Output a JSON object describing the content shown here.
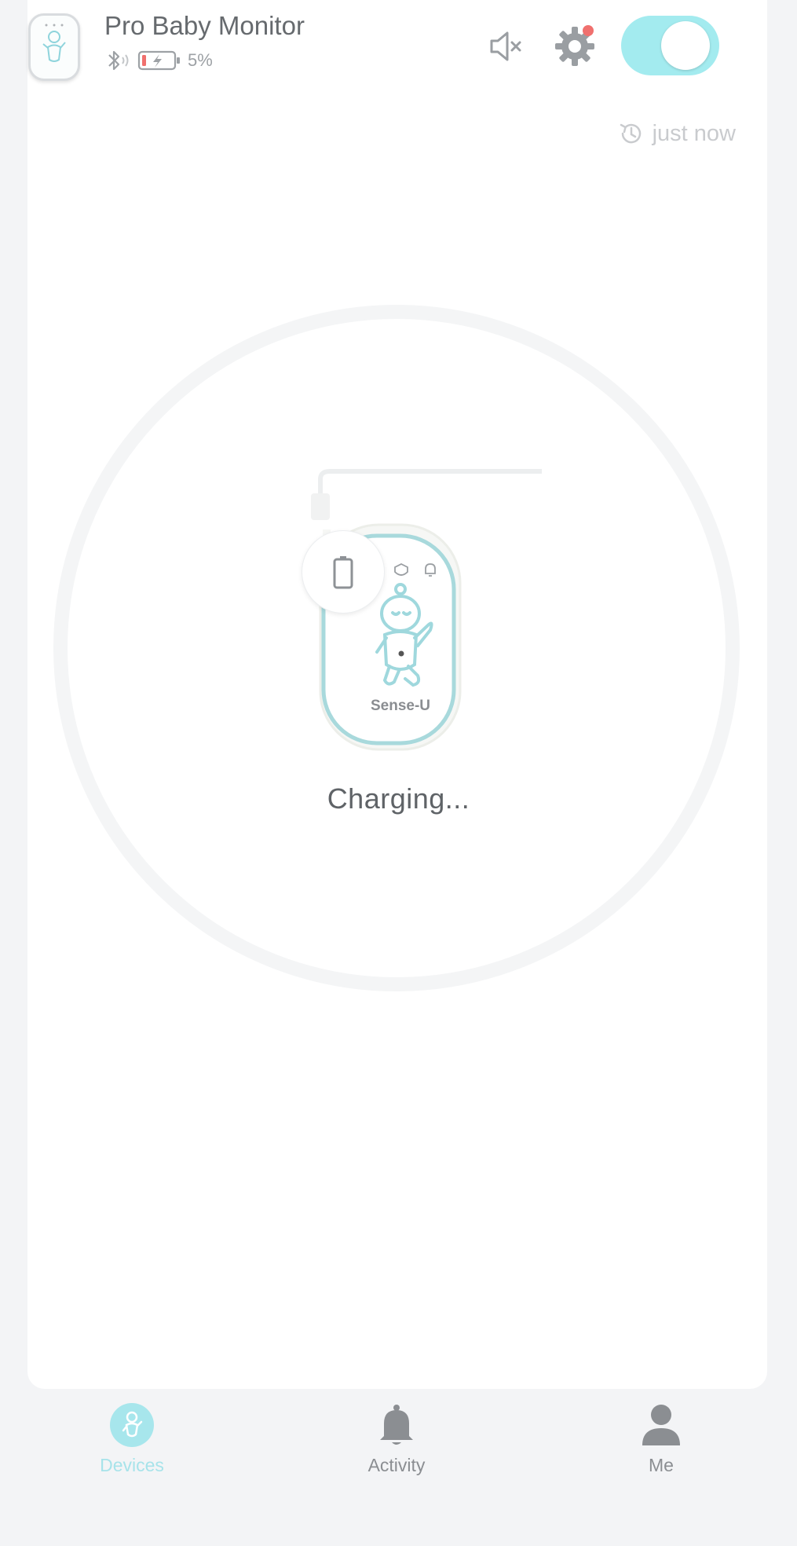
{
  "header": {
    "device_name": "Pro Baby Monitor",
    "battery_percent_label": "5%",
    "battery_level": 0.05,
    "monitor_toggle_on": true,
    "last_update_label": "just now",
    "thumbnail_brand": "Sense-U"
  },
  "main": {
    "status_text": "Charging...",
    "device_brand": "Sense-U"
  },
  "tabs": [
    {
      "label": "Devices",
      "icon": "baby-icon",
      "active": true
    },
    {
      "label": "Activity",
      "icon": "bell-icon",
      "active": false
    },
    {
      "label": "Me",
      "icon": "person-icon",
      "active": false
    }
  ],
  "colors": {
    "accent": "#a3ebef",
    "accent_text": "#a7e3ea",
    "notification_dot": "#f0706e",
    "battery_low": "#f0706e",
    "icon_gray": "#8b8e92"
  }
}
